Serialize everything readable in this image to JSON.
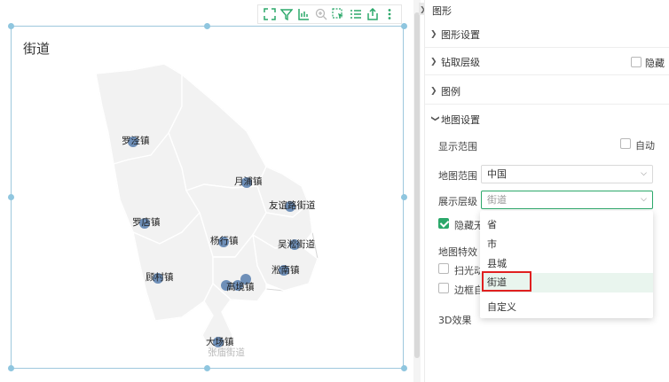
{
  "chart": {
    "title": "街道",
    "towns": [
      {
        "label": "罗泾镇"
      },
      {
        "label": "月浦镇"
      },
      {
        "label": "友谊路街道"
      },
      {
        "label": "罗店镇"
      },
      {
        "label": "杨行镇"
      },
      {
        "label": "吴淞街道"
      },
      {
        "label": "淞南镇"
      },
      {
        "label": "顾村镇"
      },
      {
        "label": "高境镇"
      },
      {
        "label": "大场镇"
      },
      {
        "label": "张庙街道"
      }
    ]
  },
  "toolbar": {
    "icons": [
      "fullscreen-icon",
      "filter-icon",
      "chart-type-icon",
      "zoom-icon",
      "select-icon",
      "list-icon",
      "export-icon",
      "more-icon"
    ]
  },
  "panel": {
    "title": "图形",
    "sections": {
      "graphic_settings": "图形设置",
      "drill_level": "钻取层级",
      "hide": "隐藏",
      "legend": "图例",
      "map_settings": "地图设置"
    },
    "display_range": {
      "label": "显示范围",
      "auto_label": "自动"
    },
    "map_range": {
      "label": "地图范围",
      "value": "中国"
    },
    "display_level": {
      "label": "展示层级",
      "value": "街道"
    },
    "hide_no_data": "隐藏无",
    "map_effects": "地图特效",
    "scan_light": "扫光动",
    "border_glow": "边框自",
    "effect_3d": "3D效果",
    "dropdown_options": [
      "省",
      "市",
      "县城",
      "街道",
      "自定义"
    ]
  }
}
